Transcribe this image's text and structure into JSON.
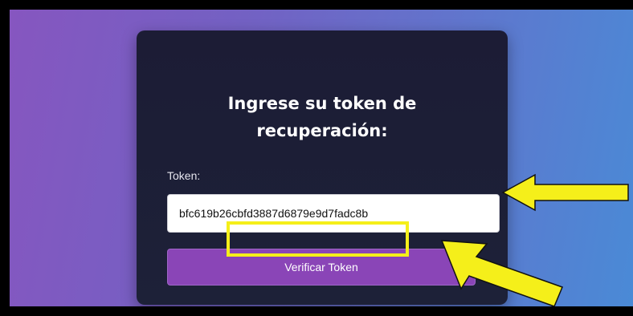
{
  "form": {
    "title_line1": "Ingrese su token de",
    "title_line2": "recuperación:",
    "token_label": "Token:",
    "token_value": "bfc619b26cbfd3887d6879e9d7fadc8b",
    "verify_button_label": "Verificar Token"
  },
  "colors": {
    "background_start": "#8656c0",
    "background_end": "#4a8ad6",
    "card": "#1c1c35",
    "button": "#8a45b7",
    "annotation_yellow": "#f5ef1a"
  },
  "icons": {
    "input_pointer": "arrow-left-icon",
    "button_pointer": "arrow-up-left-icon"
  }
}
